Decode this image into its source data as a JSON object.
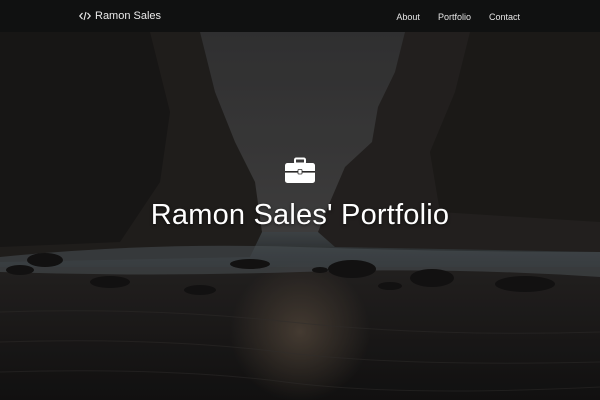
{
  "navbar": {
    "brand_icon": "code-icon",
    "brand_label": "Ramon Sales",
    "links": [
      {
        "label": "About"
      },
      {
        "label": "Portfolio"
      },
      {
        "label": "Contact"
      }
    ]
  },
  "hero": {
    "icon": "briefcase-icon",
    "title": "Ramon Sales' Portfolio"
  },
  "colors": {
    "navbar_bg": "#101111",
    "text": "#ffffff"
  }
}
